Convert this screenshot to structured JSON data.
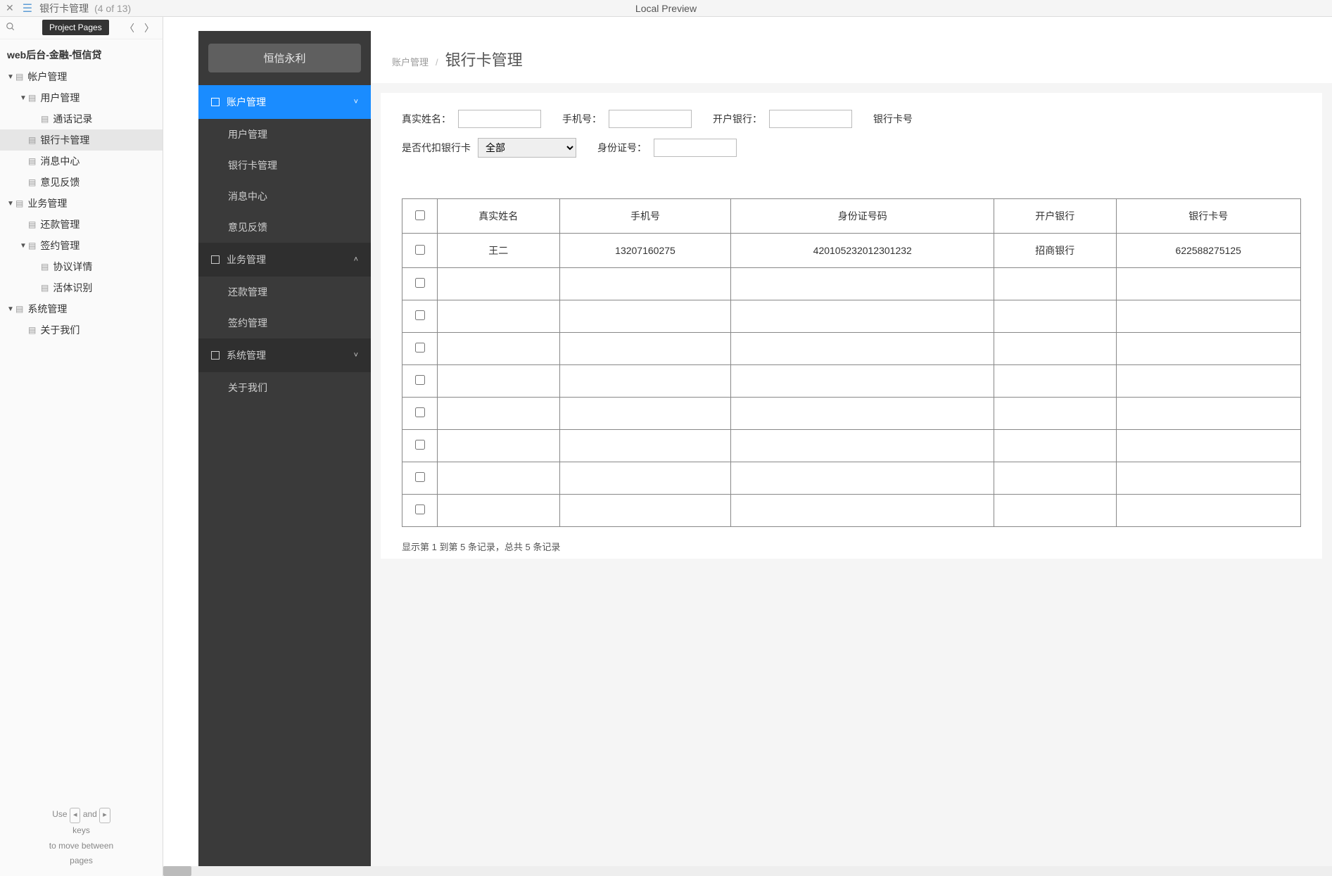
{
  "topbar": {
    "title": "银行卡管理",
    "counter": "(4 of 13)",
    "preview_label": "Local Preview",
    "tooltip": "Project Pages"
  },
  "project_tree": {
    "title": "web后台-金融-恒信贷",
    "nodes": [
      {
        "label": "帐户管理",
        "level": 1,
        "expandable": true
      },
      {
        "label": "用户管理",
        "level": 2,
        "expandable": true
      },
      {
        "label": "通话记录",
        "level": 3,
        "expandable": false
      },
      {
        "label": "银行卡管理",
        "level": 2,
        "expandable": false,
        "selected": true
      },
      {
        "label": "消息中心",
        "level": 2,
        "expandable": false
      },
      {
        "label": "意见反馈",
        "level": 2,
        "expandable": false
      },
      {
        "label": "业务管理",
        "level": 1,
        "expandable": true
      },
      {
        "label": "还款管理",
        "level": 2,
        "expandable": false
      },
      {
        "label": "签约管理",
        "level": 2,
        "expandable": true
      },
      {
        "label": "协议详情",
        "level": 3,
        "expandable": false
      },
      {
        "label": "活体识别",
        "level": 3,
        "expandable": false
      },
      {
        "label": "系统管理",
        "level": 1,
        "expandable": true
      },
      {
        "label": "关于我们",
        "level": 2,
        "expandable": false
      }
    ],
    "hint_use": "Use",
    "hint_and": "and",
    "hint_keys": "keys",
    "hint_move": "to move between",
    "hint_pages": "pages"
  },
  "app": {
    "brand": "恒信永利",
    "menu": [
      {
        "label": "账户管理",
        "type": "head",
        "active": true,
        "arrow": "down"
      },
      {
        "label": "用户管理",
        "type": "item"
      },
      {
        "label": "银行卡管理",
        "type": "item"
      },
      {
        "label": "消息中心",
        "type": "item"
      },
      {
        "label": "意见反馈",
        "type": "item"
      },
      {
        "label": "业务管理",
        "type": "head",
        "dark": true,
        "arrow": "up"
      },
      {
        "label": "还款管理",
        "type": "item"
      },
      {
        "label": "签约管理",
        "type": "item"
      },
      {
        "label": "系统管理",
        "type": "head",
        "dark": true,
        "arrow": "down"
      },
      {
        "label": "关于我们",
        "type": "item"
      }
    ],
    "breadcrumb": {
      "a": "账户管理",
      "b": "银行卡管理"
    },
    "filters": {
      "real_name": "真实姓名：",
      "phone": "手机号：",
      "bank": "开户银行：",
      "card_no": "银行卡号",
      "is_proxy": "是否代扣银行卡",
      "proxy_value": "全部",
      "id_no": "身份证号："
    },
    "table": {
      "headers": [
        "真实姓名",
        "手机号",
        "身份证号码",
        "开户银行",
        "银行卡号"
      ],
      "rows": [
        {
          "name": "王二",
          "phone": "13207160275",
          "id": "42010523201230​1232",
          "bank": "招商银行",
          "card": "622588275125"
        },
        {
          "name": "",
          "phone": "",
          "id": "",
          "bank": "",
          "card": ""
        },
        {
          "name": "",
          "phone": "",
          "id": "",
          "bank": "",
          "card": ""
        },
        {
          "name": "",
          "phone": "",
          "id": "",
          "bank": "",
          "card": ""
        },
        {
          "name": "",
          "phone": "",
          "id": "",
          "bank": "",
          "card": ""
        },
        {
          "name": "",
          "phone": "",
          "id": "",
          "bank": "",
          "card": ""
        },
        {
          "name": "",
          "phone": "",
          "id": "",
          "bank": "",
          "card": ""
        },
        {
          "name": "",
          "phone": "",
          "id": "",
          "bank": "",
          "card": ""
        },
        {
          "name": "",
          "phone": "",
          "id": "",
          "bank": "",
          "card": ""
        }
      ],
      "footer": "显示第 1 到第 5 条记录，总共 5 条记录"
    }
  }
}
